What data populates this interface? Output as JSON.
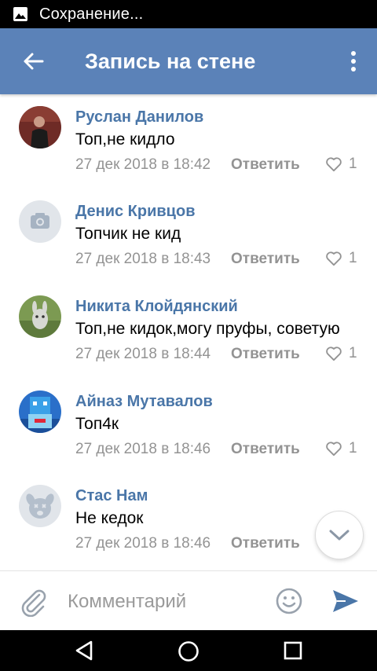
{
  "status_bar": {
    "text": "Сохранение..."
  },
  "header": {
    "title": "Запись на стене"
  },
  "comments": [
    {
      "author": "Руслан Данилов",
      "text": "Топ,не кидло",
      "date": "27 дек 2018 в 18:42",
      "reply_label": "Ответить",
      "likes": "1",
      "avatar": "photo-avatar"
    },
    {
      "author": "Денис Кривцов",
      "text": "Топчик не кид",
      "date": "27 дек 2018 в 18:43",
      "reply_label": "Ответить",
      "likes": "1",
      "avatar": "camera-placeholder-avatar"
    },
    {
      "author": "Никита Клойдянский",
      "text": "Топ,не кидок,могу пруфы, советую",
      "date": "27 дек 2018 в 18:44",
      "reply_label": "Ответить",
      "likes": "1",
      "avatar": "photo-avatar"
    },
    {
      "author": "Айназ Мутавалов",
      "text": "Топ4к",
      "date": "27 дек 2018 в 18:46",
      "reply_label": "Ответить",
      "likes": "1",
      "avatar": "photo-avatar"
    },
    {
      "author": "Стас Нам",
      "text": "Не кедок",
      "date": "27 дек 2018 в 18:46",
      "reply_label": "Ответить",
      "likes": "",
      "avatar": "deactivated-dog-avatar"
    }
  ],
  "composer": {
    "placeholder": "Комментарий"
  },
  "colors": {
    "header": "#5b82b8",
    "link": "#4a76a8",
    "muted": "#939393",
    "send": "#4a76a8"
  },
  "icons": [
    "image-icon",
    "back-arrow-icon",
    "more-vertical-icon",
    "heart-icon",
    "chevron-down-icon",
    "paperclip-icon",
    "emoji-icon",
    "send-icon",
    "nav-back-icon",
    "nav-home-icon",
    "nav-recents-icon"
  ]
}
